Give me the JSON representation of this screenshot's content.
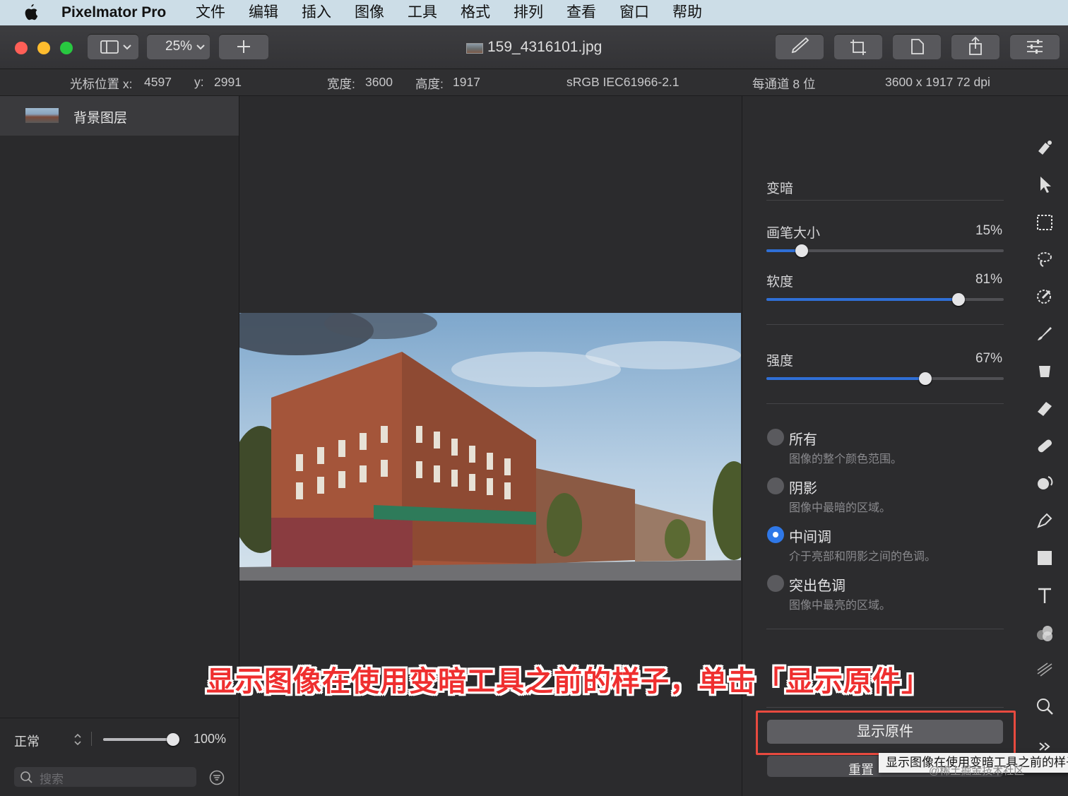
{
  "menubar": {
    "app_name": "Pixelmator Pro",
    "items": [
      "文件",
      "编辑",
      "插入",
      "图像",
      "工具",
      "格式",
      "排列",
      "查看",
      "窗口",
      "帮助"
    ]
  },
  "toolbar": {
    "zoom": "25%",
    "document_title": "159_4316101.jpg",
    "sidebar_icon": "sidebar-icon",
    "add_icon": "plus-icon",
    "right_buttons": [
      "brush-tool-icon",
      "crop-icon",
      "document-icon",
      "share-icon",
      "adjustments-icon"
    ]
  },
  "infobar": {
    "cursor_x_label": "光标位置 x:",
    "cursor_x": "4597",
    "cursor_y_label": "y:",
    "cursor_y": "2991",
    "width_label": "宽度:",
    "width": "3600",
    "height_label": "高度:",
    "height": "1917",
    "color_profile": "sRGB IEC61966-2.1",
    "bit_depth": "每通道 8 位",
    "dimensions": "3600 x 1917 72 dpi"
  },
  "layers": {
    "items": [
      {
        "name": "背景图层"
      }
    ],
    "blend_mode": "正常",
    "opacity": "100%",
    "opacity_value": 100,
    "search_placeholder": "搜索"
  },
  "tool_panel": {
    "title": "变暗",
    "brush_size": {
      "label": "画笔大小",
      "value": "15%",
      "level": 0.15
    },
    "softness": {
      "label": "软度",
      "value": "81%",
      "level": 0.81
    },
    "strength": {
      "label": "强度",
      "value": "67%",
      "level": 0.67
    },
    "ranges": [
      {
        "title": "所有",
        "desc": "图像的整个颜色范围。",
        "selected": false
      },
      {
        "title": "阴影",
        "desc": "图像中最暗的区域。",
        "selected": false
      },
      {
        "title": "中间调",
        "desc": "介于亮部和阴影之间的色调。",
        "selected": true
      },
      {
        "title": "突出色调",
        "desc": "图像中最亮的区域。",
        "selected": false
      }
    ],
    "show_original_label": "显示原件",
    "reset_label": "重置"
  },
  "tools": [
    "paint-bucket-style-icon",
    "arrow-select-icon",
    "rect-select-icon",
    "lasso-icon",
    "color-picker-icon",
    "paint-brush-icon",
    "fill-bucket-icon",
    "eraser-icon",
    "bandage-repair-icon",
    "clone-icon",
    "pen-icon",
    "rectangle-shape-icon",
    "text-icon",
    "color-adjust-icon",
    "blur-icon",
    "zoom-icon",
    "more-icon"
  ],
  "overlay": {
    "caption": "显示图像在使用变暗工具之前的样子，单击「显示原件」",
    "tooltip": "显示图像在使用变暗工具之前的样子",
    "watermark": "@稀土掘金技术社区"
  },
  "colors": {
    "accent": "#2f6fd6",
    "highlight": "#e84a3f",
    "caption": "#ef2f2f"
  }
}
